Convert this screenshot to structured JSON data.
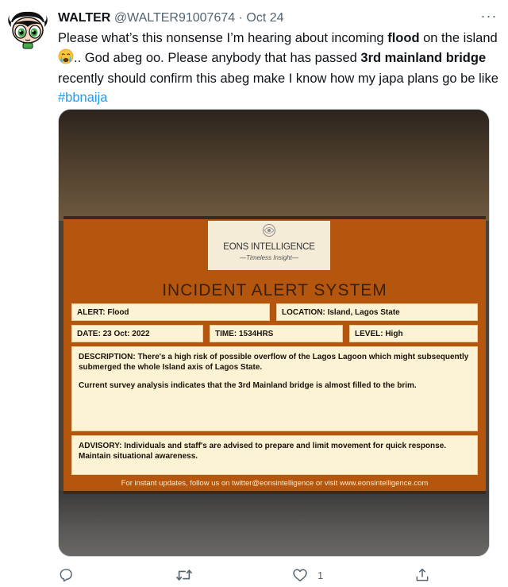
{
  "tweet": {
    "author_name": "WALTER",
    "handle": "@WALTER91007674",
    "separator": "·",
    "date": "Oct 24",
    "more_label": "···",
    "text": {
      "part1": "Please what’s this nonsense I’m hearing about incoming ",
      "bold1": "flood",
      "part2": " on the island ",
      "part3": ".. God abeg oo. Please anybody that has passed ",
      "bold2": "3rd mainland bridge",
      "part4": " recently should confirm this abeg make I know how my japa plans go be like ",
      "hashtag": "#bbnaija"
    }
  },
  "media": {
    "brand": "EONS INTELLIGENCE",
    "slogan": "—Timeless Insight—",
    "title": "INCIDENT ALERT SYSTEM",
    "alert": "ALERT: Flood",
    "location": "LOCATION: Island, Lagos State",
    "date": "DATE: 23 Oct: 2022",
    "time": "TIME: 1534HRS",
    "level": "LEVEL: High",
    "description_1": "DESCRIPTION: There's a high risk of possible overflow of the Lagos Lagoon which might subsequently submerged the whole Island axis of Lagos State.",
    "description_2": "Current survey analysis indicates that the 3rd Mainland bridge is almost filled to the brim.",
    "advisory": "ADVISORY: Individuals and staff's are advised to prepare and limit movement for quick response. Maintain situational awareness.",
    "footer": "For instant updates, follow us on twitter@eonsintelligence or visit www.eonsintelligence.com"
  },
  "actions": {
    "like_count": "1"
  },
  "colors": {
    "text": "#0f1419",
    "secondary": "#536471",
    "link": "#1d9bf0",
    "poster_orange": "#b5560e",
    "poster_field": "#fbf3d4"
  }
}
